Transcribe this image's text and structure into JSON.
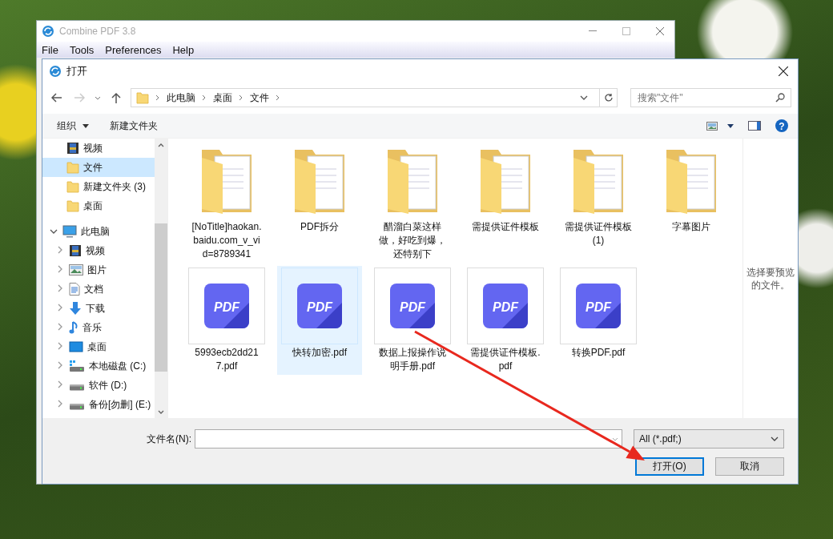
{
  "app_window": {
    "title": "Combine PDF 3.8",
    "menu": [
      "File",
      "Tools",
      "Preferences",
      "Help"
    ]
  },
  "dialog": {
    "title": "打开",
    "breadcrumb": [
      "此电脑",
      "桌面",
      "文件"
    ],
    "search": {
      "placeholder": "搜索\"文件\""
    },
    "toolbar": {
      "organize": "组织",
      "new_folder": "新建文件夹"
    },
    "sidebar": {
      "items": [
        {
          "label": "视频",
          "kind": "video",
          "selected": false
        },
        {
          "label": "文件",
          "kind": "folder",
          "selected": true
        },
        {
          "label": "新建文件夹 (3)",
          "kind": "folder",
          "selected": false
        },
        {
          "label": "桌面",
          "kind": "folder",
          "selected": false
        },
        {
          "label": "此电脑",
          "kind": "computer",
          "selected": false,
          "expanded": true,
          "children": [
            {
              "label": "视频",
              "kind": "video",
              "selected": false,
              "expanded": false
            },
            {
              "label": "图片",
              "kind": "picture",
              "selected": false,
              "expanded": false
            },
            {
              "label": "文档",
              "kind": "document",
              "selected": false,
              "expanded": false
            },
            {
              "label": "下载",
              "kind": "download",
              "selected": false,
              "expanded": false
            },
            {
              "label": "音乐",
              "kind": "music",
              "selected": false,
              "expanded": false
            },
            {
              "label": "桌面",
              "kind": "desktop",
              "selected": false,
              "expanded": false
            },
            {
              "label": "本地磁盘 (C:)",
              "kind": "system-drive",
              "selected": false,
              "expanded": false
            },
            {
              "label": "软件 (D:)",
              "kind": "drive",
              "selected": false,
              "expanded": false
            },
            {
              "label": "备份[勿删] (E:)",
              "kind": "drive",
              "selected": false,
              "expanded": false
            }
          ]
        }
      ]
    },
    "files": [
      {
        "name": "[NoTitle]haokan.baidu.com_v_vid=8789341",
        "kind": "folder",
        "selected": false
      },
      {
        "name": "PDF拆分",
        "kind": "folder",
        "selected": false
      },
      {
        "name": "醋溜白菜这样做，好吃到爆，还特别下",
        "kind": "folder",
        "selected": false
      },
      {
        "name": "需提供证件模板",
        "kind": "folder",
        "selected": false
      },
      {
        "name": "需提供证件模板(1)",
        "kind": "folder",
        "selected": false
      },
      {
        "name": "字幕图片",
        "kind": "folder",
        "selected": false
      },
      {
        "name": "5993ecb2dd217.pdf",
        "kind": "pdf",
        "icon_text": "PDF",
        "selected": false
      },
      {
        "name": "快转加密.pdf",
        "kind": "pdf",
        "icon_text": "PDF",
        "selected": true
      },
      {
        "name": "数据上报操作说明手册.pdf",
        "kind": "pdf",
        "icon_text": "PDF",
        "selected": false
      },
      {
        "name": "需提供证件模板.pdf",
        "kind": "pdf",
        "icon_text": "PDF",
        "selected": false
      },
      {
        "name": "转换PDF.pdf",
        "kind": "pdf",
        "icon_text": "PDF",
        "selected": false
      }
    ],
    "help_glyph": "?",
    "preview_hint": "选择要预览的文件。",
    "filename_label": "文件名(N):",
    "filter": "All (*.pdf;)",
    "buttons": [
      {
        "label": "打开(O)",
        "default": true
      },
      {
        "label": "取消",
        "default": false
      }
    ]
  }
}
